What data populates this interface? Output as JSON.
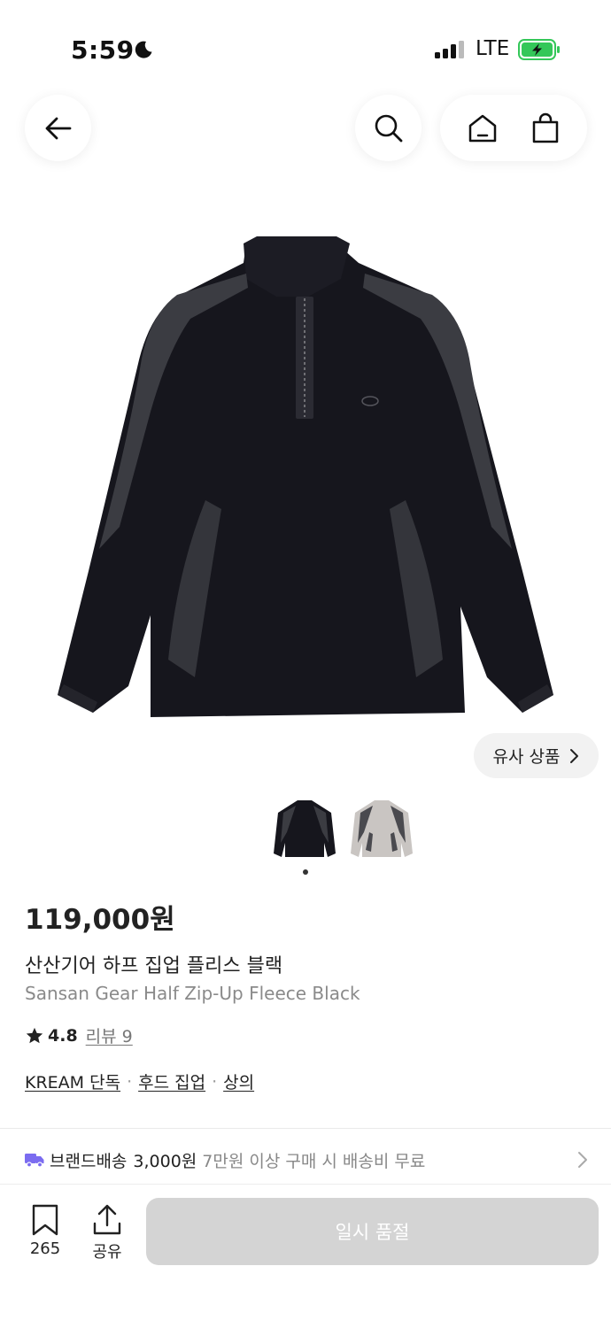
{
  "status_bar": {
    "time": "5:59",
    "network": "LTE",
    "battery_color": "#34c759"
  },
  "nav": {
    "back_icon": "arrow-left-icon",
    "search_icon": "search-icon",
    "home_icon": "home-icon",
    "bag_icon": "shopping-bag-icon"
  },
  "gallery": {
    "similar_label": "유사 상품",
    "thumbnails": [
      "black",
      "gray"
    ],
    "active_index": 0
  },
  "product": {
    "price": "119,000원",
    "name_ko": "산산기어 하프 집업 플리스 블랙",
    "name_en": "Sansan Gear Half Zip-Up Fleece Black",
    "rating": "4.8",
    "review_label": "리뷰 9",
    "tags": [
      "KREAM 단독",
      "후드 집업",
      "상의"
    ],
    "tag_separator": "·"
  },
  "shipping": {
    "label": "브랜드배송",
    "price": "3,000원",
    "note": "7만원 이상 구매 시 배송비 무료",
    "icon_color": "#7b6cf0"
  },
  "bottom_bar": {
    "bookmark_count": "265",
    "share_label": "공유",
    "soldout_label": "일시 품절"
  }
}
